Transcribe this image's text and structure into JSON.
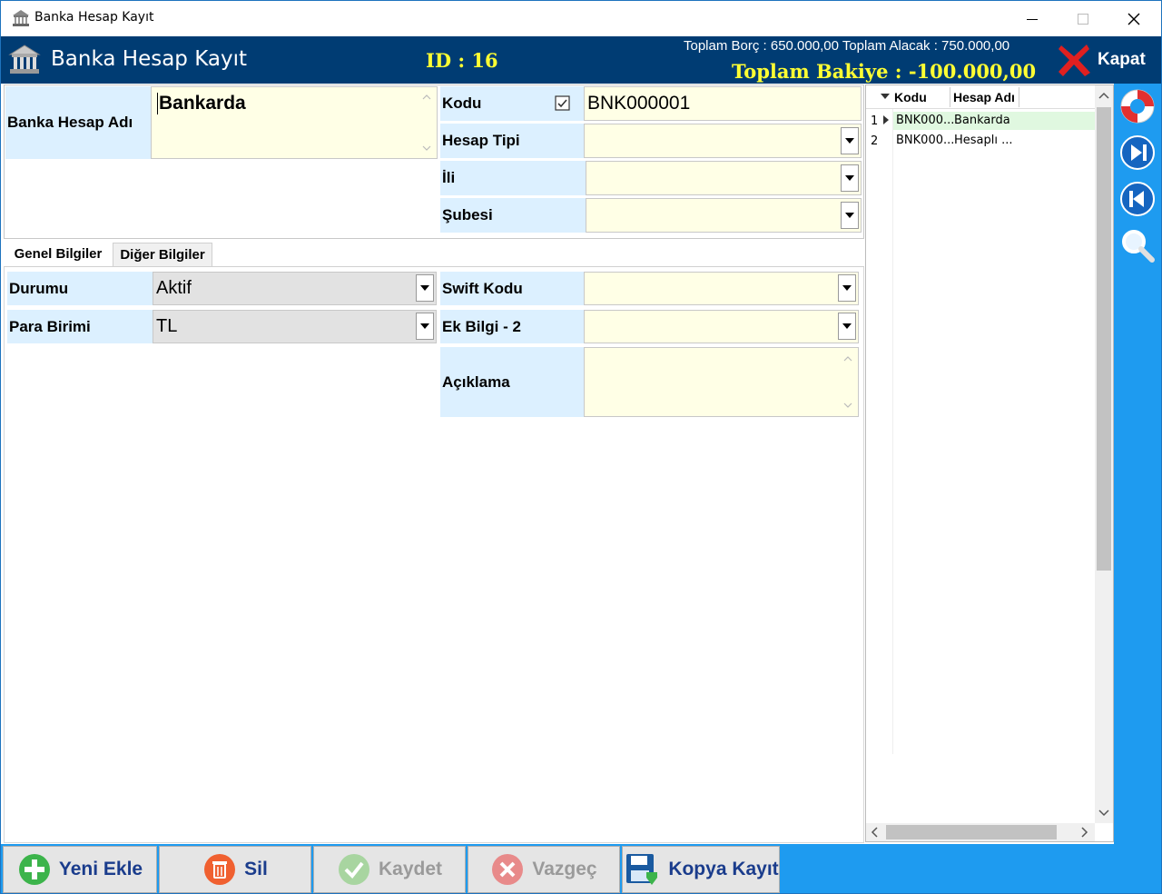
{
  "window": {
    "title": "Banka Hesap Kayıt"
  },
  "header": {
    "title": "Banka Hesap Kayıt",
    "id_text": "ID : 16",
    "totals_text": "Toplam Borç : 650.000,00  Toplam Alacak : 750.000,00",
    "bakiye_text": "Toplam Bakiye : -100.000,00",
    "close_label": "Kapat"
  },
  "form": {
    "banka_hesap_adi_label": "Banka Hesap Adı",
    "banka_hesap_adi_value": "Bankarda",
    "kodu_label": "Kodu",
    "kodu_value": "BNK000001",
    "hesap_tipi_label": "Hesap Tipi",
    "hesap_tipi_value": "",
    "ili_label": "İli",
    "ili_value": "",
    "subesi_label": "Şubesi",
    "subesi_value": ""
  },
  "tabs": [
    {
      "label": "Genel Bilgiler"
    },
    {
      "label": "Diğer Bilgiler"
    }
  ],
  "genel": {
    "durumu_label": "Durumu",
    "durumu_value": "Aktif",
    "para_birimi_label": "Para Birimi",
    "para_birimi_value": "TL",
    "swift_kodu_label": "Swift Kodu",
    "swift_kodu_value": "",
    "ek_bilgi_label": "Ek Bilgi - 2",
    "ek_bilgi_value": "",
    "aciklama_label": "Açıklama",
    "aciklama_value": ""
  },
  "grid": {
    "columns": [
      "Kodu",
      "Hesap Adı"
    ],
    "rows": [
      {
        "num": "1",
        "kodu": "BNK000...",
        "hesap_adi": "Bankarda"
      },
      {
        "num": "2",
        "kodu": "BNK000...",
        "hesap_adi": "Hesaplı ..."
      }
    ]
  },
  "buttons": {
    "yeni_ekle": "Yeni Ekle",
    "sil": "Sil",
    "kaydet": "Kaydet",
    "vazgec": "Vazgeç",
    "kopya_kayit": "Kopya Kayıt"
  },
  "colors": {
    "header_bg": "#003c73",
    "accent_blue": "#1e9bf0",
    "highlight_yellow": "#ffff33",
    "label_bg": "#dcf0ff",
    "input_bg": "#ffffe6"
  },
  "icons": {
    "app": "bank-icon",
    "close": "red-x-icon",
    "help": "lifebuoy-icon",
    "next": "skip-next-icon",
    "prev": "skip-previous-icon",
    "search": "magnifier-icon",
    "add": "plus-circle-icon",
    "delete": "trash-icon",
    "save": "check-circle-icon",
    "cancel": "x-circle-icon",
    "copy": "floppy-save-icon"
  }
}
